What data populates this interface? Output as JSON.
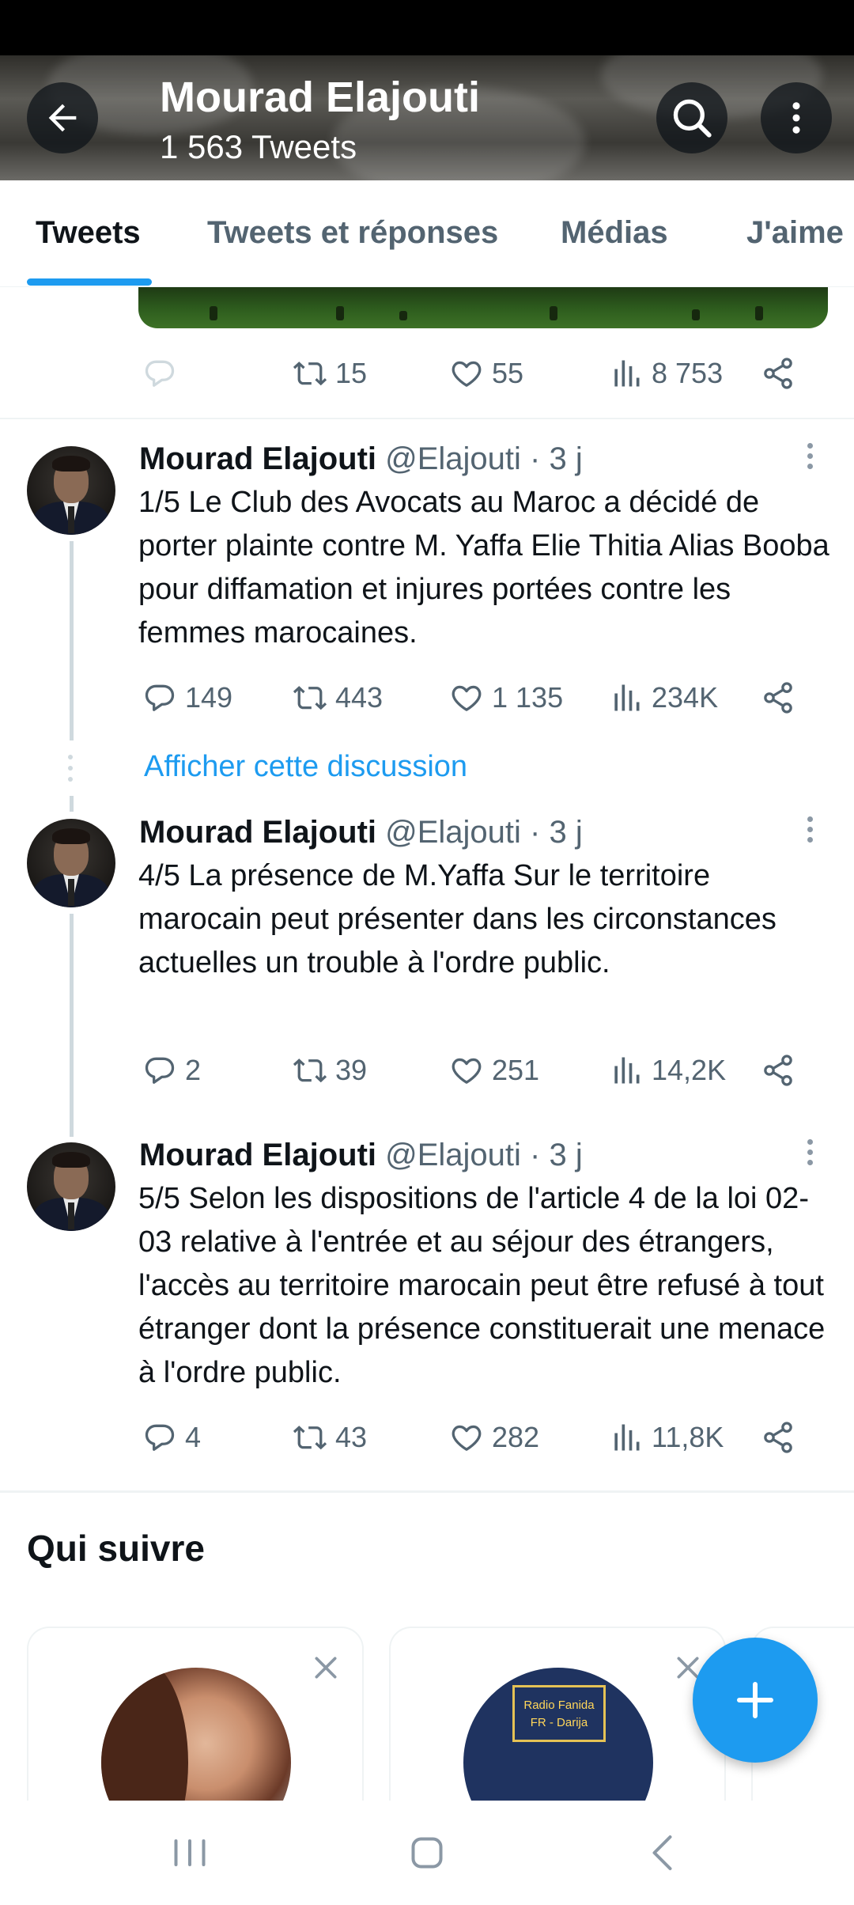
{
  "header": {
    "title": "Mourad Elajouti",
    "tweet_count": "1 563 Tweets"
  },
  "tabs": [
    {
      "label": "Tweets",
      "active": true
    },
    {
      "label": "Tweets et réponses",
      "active": false
    },
    {
      "label": "Médias",
      "active": false
    },
    {
      "label": "J'aime",
      "active": false
    }
  ],
  "previous_tweet": {
    "replies": "",
    "retweets": "15",
    "likes": "55",
    "views": "8 753"
  },
  "tweets": [
    {
      "name": "Mourad Elajouti",
      "handle": "@Elajouti · 3 j",
      "text": "1/5 Le Club des Avocats au Maroc a décidé de porter plainte contre M. Yaffa Elie Thitia Alias Booba pour diffamation et injures portées contre les femmes marocaines.",
      "replies": "149",
      "retweets": "443",
      "likes": "1 135",
      "views": "234K"
    },
    {
      "name": "Mourad Elajouti",
      "handle": "@Elajouti · 3 j",
      "text": "4/5 La présence de M.Yaffa Sur le territoire marocain peut présenter dans les circonstances actuelles un trouble à l'ordre public.",
      "replies": "2",
      "retweets": "39",
      "likes": "251",
      "views": "14,2K"
    },
    {
      "name": "Mourad Elajouti",
      "handle": "@Elajouti · 3 j",
      "text": "5/5 Selon les dispositions de l'article 4 de la loi 02-03 relative à l'entrée et au séjour des étrangers, l'accès au territoire marocain peut être refusé à tout étranger dont la présence constituerait une menace à l'ordre public.",
      "replies": "4",
      "retweets": "43",
      "likes": "282",
      "views": "11,8K"
    }
  ],
  "show_thread": "Afficher cette discussion",
  "who_to_follow": {
    "title": "Qui suivre",
    "card2_banner": "Radio Fanida FR - Darija"
  },
  "colors": {
    "accent": "#1d9bf0",
    "text": "#0f1419",
    "secondary": "#536471"
  }
}
